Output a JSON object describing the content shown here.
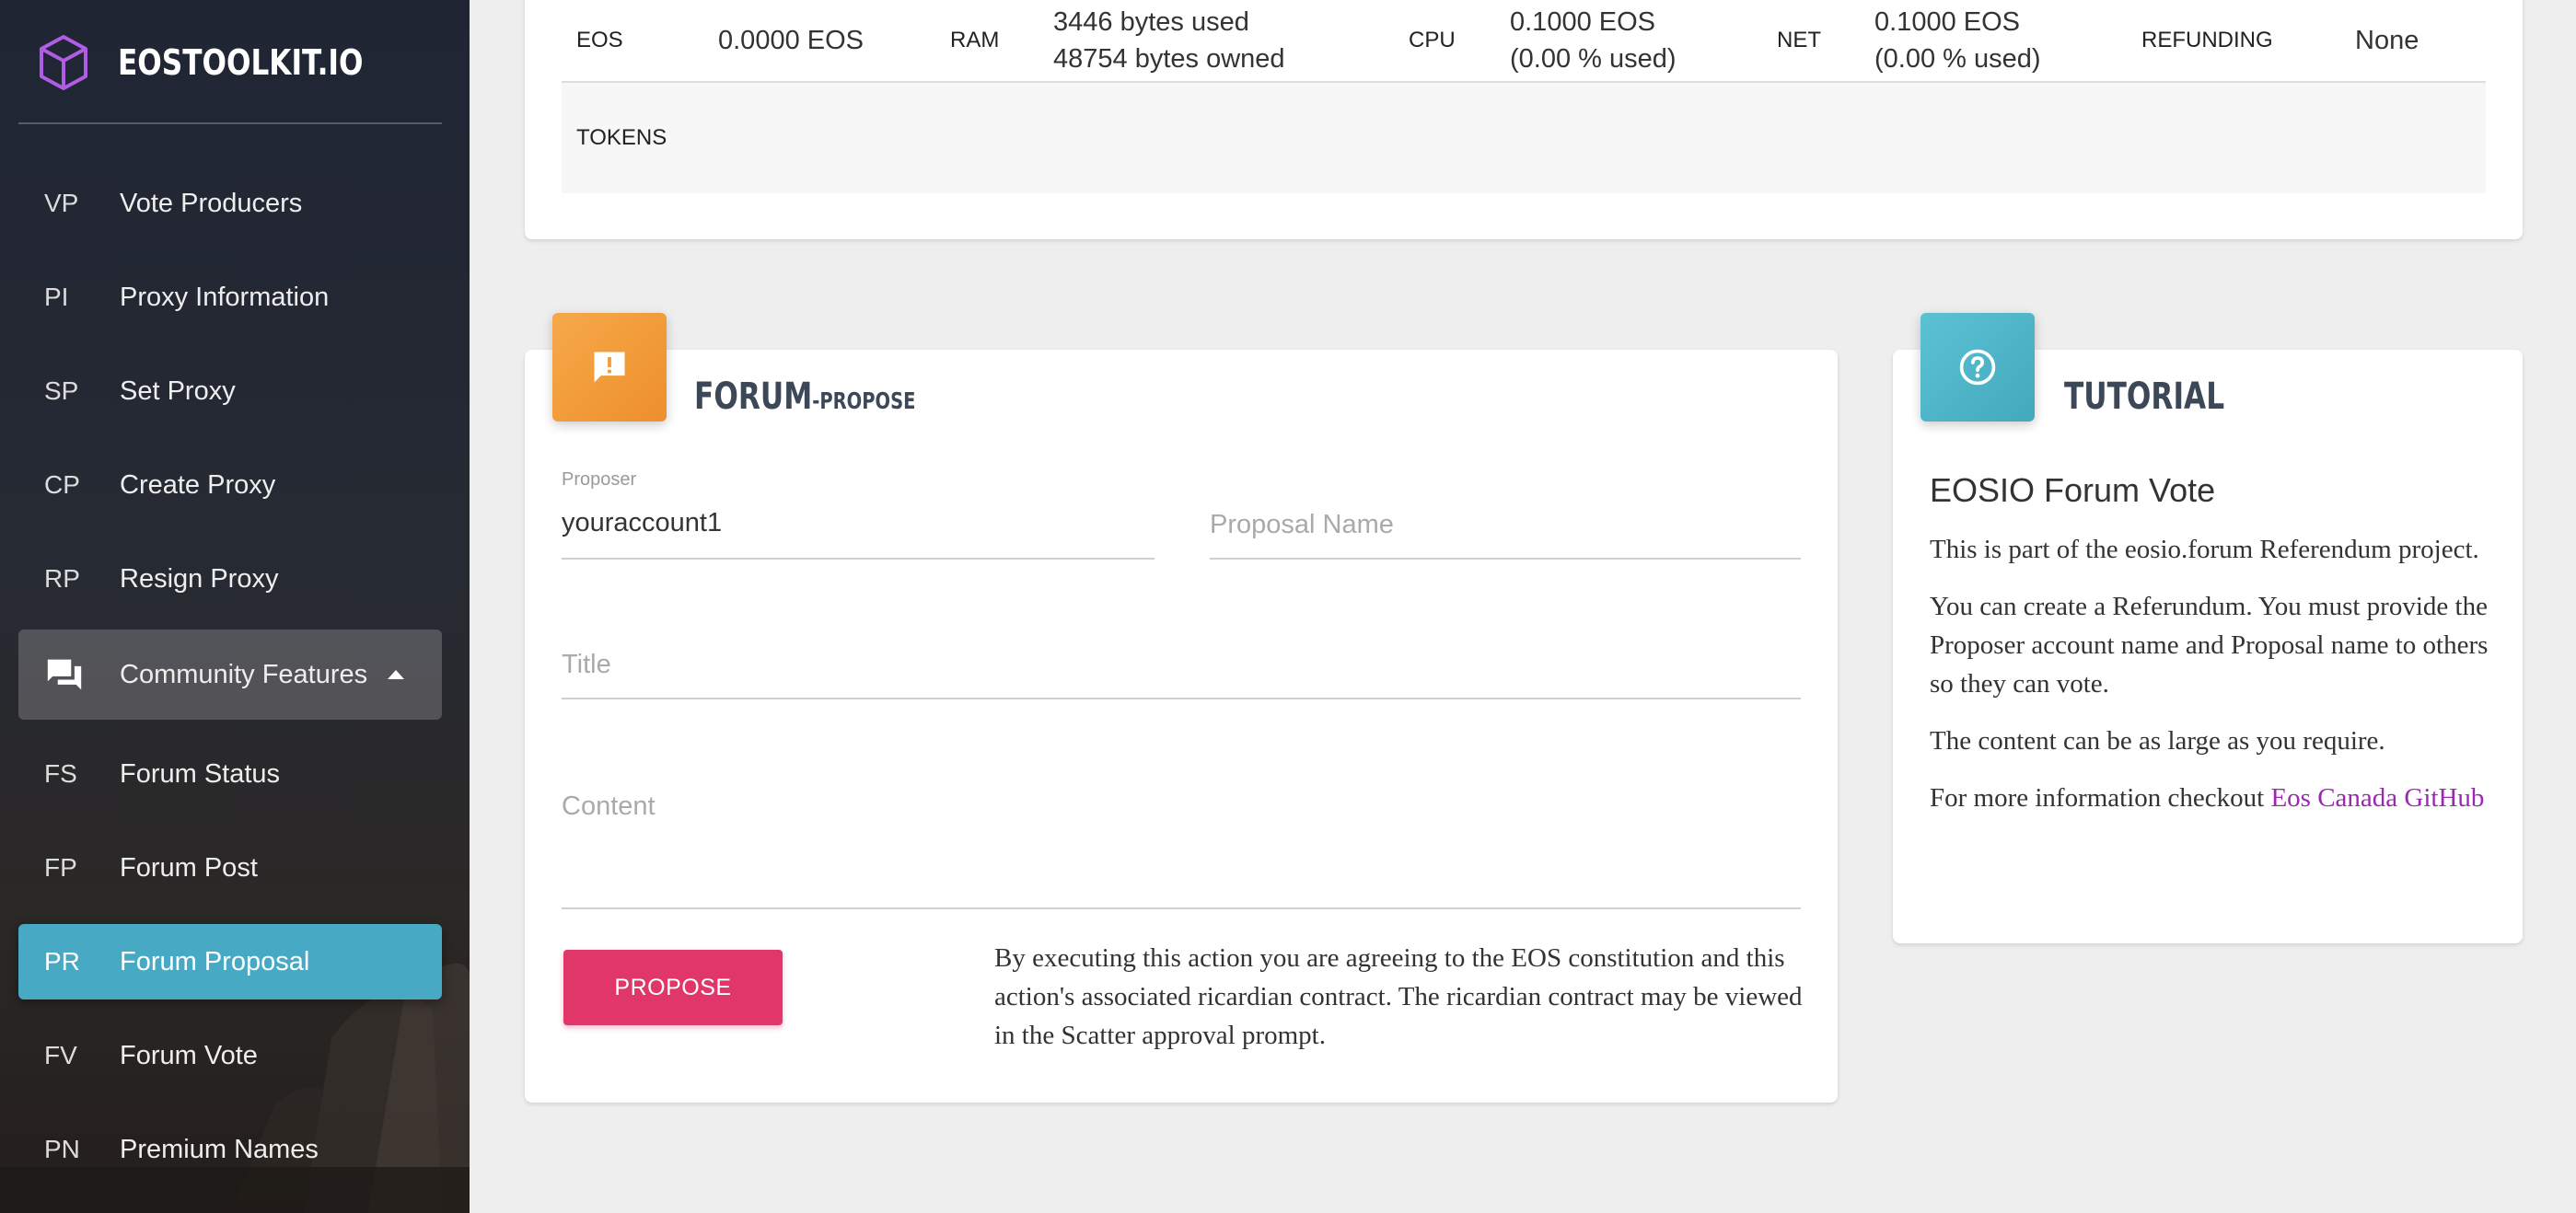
{
  "brand": {
    "name": "EOSTOOLKIT.IO"
  },
  "sidebar": {
    "items": [
      {
        "abbr": "VP",
        "label": "Vote Producers"
      },
      {
        "abbr": "PI",
        "label": "Proxy Information"
      },
      {
        "abbr": "SP",
        "label": "Set Proxy"
      },
      {
        "abbr": "CP",
        "label": "Create Proxy"
      },
      {
        "abbr": "RP",
        "label": "Resign Proxy"
      }
    ],
    "group": {
      "label": "Community Features",
      "icon": "forum-icon",
      "expanded": true
    },
    "subitems": [
      {
        "abbr": "FS",
        "label": "Forum Status"
      },
      {
        "abbr": "FP",
        "label": "Forum Post"
      },
      {
        "abbr": "PR",
        "label": "Forum Proposal",
        "active": true
      },
      {
        "abbr": "FV",
        "label": "Forum Vote"
      },
      {
        "abbr": "PN",
        "label": "Premium Names"
      }
    ],
    "active_color": "#48a9c5"
  },
  "account": {
    "eos_label": "EOS",
    "eos_value": "0.0000 EOS",
    "ram_label": "RAM",
    "ram_used": "3446 bytes used",
    "ram_owned": "48754 bytes owned",
    "cpu_label": "CPU",
    "cpu_value": "0.1000 EOS",
    "cpu_used": "(0.00 % used)",
    "net_label": "NET",
    "net_value": "0.1000 EOS",
    "net_used": "(0.00 % used)",
    "refunding_label": "REFUNDING",
    "refunding_value": "None",
    "tokens_label": "TOKENS"
  },
  "forum": {
    "title": "FORUM",
    "subtitle": "-PROPOSE",
    "icon": "alert-message-icon",
    "accent": "#f19a37",
    "proposer_label": "Proposer",
    "proposer_value": "youraccount1",
    "proposal_name_placeholder": "Proposal Name",
    "title_placeholder": "Title",
    "content_placeholder": "Content",
    "propose_label": "PROPOSE",
    "propose_color": "#e0366a",
    "disclaimer": "By executing this action you are agreeing to the EOS constitution and this action's associated ricardian contract. The ricardian contract may be viewed in the Scatter approval prompt."
  },
  "tutorial": {
    "title": "TUTORIAL",
    "icon": "help-icon",
    "heading": "EOSIO Forum Vote",
    "p1": "This is part of the eosio.forum Referendum project.",
    "p2": "You can create a Referundum. You must provide the Proposer account name and Proposal name to others so they can vote.",
    "p3": "The content can be as large as you require.",
    "p4": "For more information checkout ",
    "link": "Eos Canada GitHub",
    "link_color": "#9c27b0"
  }
}
